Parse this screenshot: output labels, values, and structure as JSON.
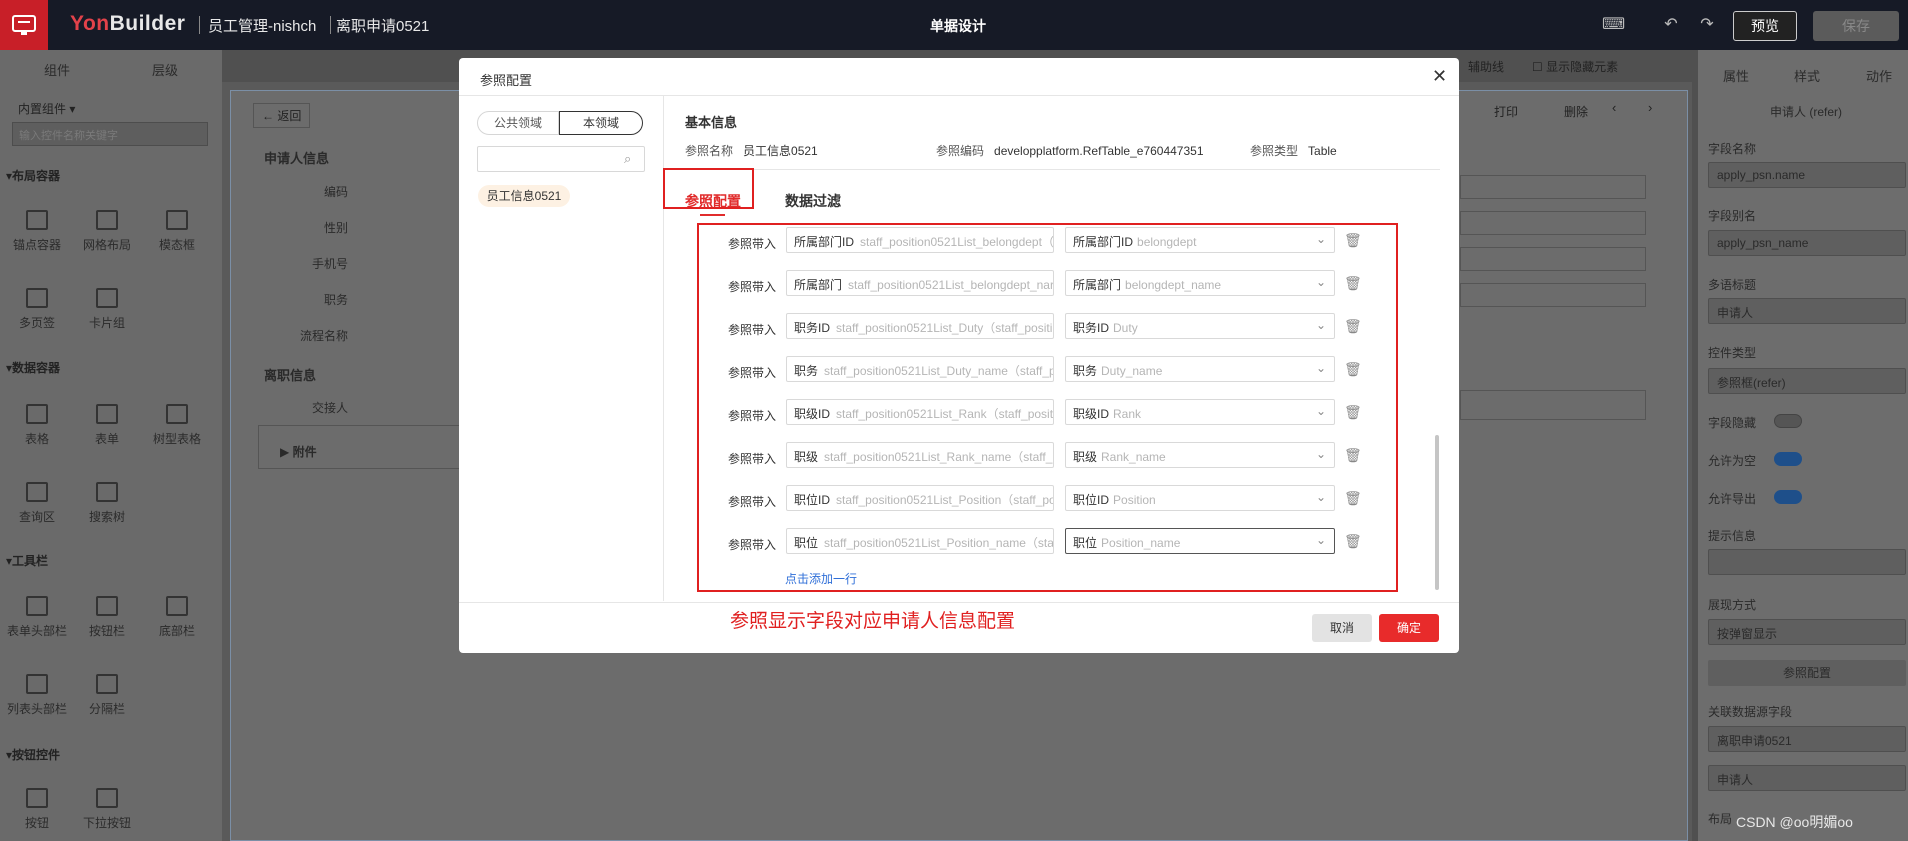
{
  "topbar": {
    "brand_prefix": "Yon",
    "brand_suffix": "Builder",
    "app_name": "员工管理-nishch",
    "page_name": "离职申请0521",
    "center_title": "单据设计",
    "preview_label": "预览",
    "save_label": "保存"
  },
  "left_panel": {
    "tabs": [
      "组件",
      "层级"
    ],
    "dropdown": "内置组件",
    "search_placeholder": "输入控件名称关键字",
    "sections": [
      {
        "title": "布局容器",
        "items": [
          "锚点容器",
          "网格布局",
          "模态框",
          "多页签",
          "卡片组"
        ]
      },
      {
        "title": "数据容器",
        "items": [
          "表格",
          "表单",
          "树型表格",
          "查询区",
          "搜索树"
        ]
      },
      {
        "title": "工具栏",
        "items": [
          "表单头部栏",
          "按钮栏",
          "底部栏",
          "列表头部栏",
          "分隔栏"
        ]
      },
      {
        "title": "按钮控件",
        "items": [
          "按钮",
          "下拉按钮"
        ]
      }
    ]
  },
  "form": {
    "back_label": "返回",
    "print_label": "打印",
    "delete_label": "删除",
    "toolbar_extra": [
      "辅助线",
      "显示隐藏元素"
    ],
    "group1": "申请人信息",
    "fields1": [
      "编码",
      "性别",
      "手机号",
      "职务",
      "流程名称"
    ],
    "group2": "离职信息",
    "fields2": [
      "交接人"
    ],
    "attachment": "附件"
  },
  "right_panel": {
    "tabs": [
      "属性",
      "样式",
      "动作"
    ],
    "subtitle": "申请人 (refer)",
    "items": [
      {
        "label": "字段名称",
        "value": "apply_psn.name"
      },
      {
        "label": "字段别名",
        "value": "apply_psn_name"
      },
      {
        "label": "多语标题",
        "value": "申请人"
      },
      {
        "label": "控件类型",
        "value": "参照框(refer)"
      }
    ],
    "field_hidden": "字段隐藏",
    "allow_empty": "允许为空",
    "allow_export": "允许导出",
    "hint_label": "提示信息",
    "display_label": "展现方式",
    "display_value": "按弹窗显示",
    "ref_config_button": "参照配置",
    "related_label": "关联数据源字段",
    "related_value": "离职申请0521",
    "related_value2": "申请人",
    "layout_label": "布局"
  },
  "modal": {
    "title": "参照配置",
    "tab_public": "公共领域",
    "tab_domain": "本领域",
    "tree_item": "员工信息0521",
    "basic_info_title": "基本信息",
    "ref_name_label": "参照名称",
    "ref_name_value": "员工信息0521",
    "ref_code_label": "参照编码",
    "ref_code_value": "developplatform.RefTable_e760447351",
    "ref_type_label": "参照类型",
    "ref_type_value": "Table",
    "tab_config": "参照配置",
    "tab_filter": "数据过滤",
    "rows": [
      {
        "label": "参照带入",
        "src": "所属部门ID",
        "src_ph": "staff_position0521List_belongdept（",
        "dst": "所属部门ID",
        "dst_ph": "belongdept"
      },
      {
        "label": "参照带入",
        "src": "所属部门",
        "src_ph": "staff_position0521List_belongdept_nar",
        "dst": "所属部门",
        "dst_ph": "belongdept_name"
      },
      {
        "label": "参照带入",
        "src": "职务ID",
        "src_ph": "staff_position0521List_Duty（staff_positi",
        "dst": "职务ID",
        "dst_ph": "Duty"
      },
      {
        "label": "参照带入",
        "src": "职务",
        "src_ph": "staff_position0521List_Duty_name（staff_p",
        "dst": "职务",
        "dst_ph": "Duty_name"
      },
      {
        "label": "参照带入",
        "src": "职级ID",
        "src_ph": "staff_position0521List_Rank（staff_positi",
        "dst": "职级ID",
        "dst_ph": "Rank"
      },
      {
        "label": "参照带入",
        "src": "职级",
        "src_ph": "staff_position0521List_Rank_name（staff_p",
        "dst": "职级",
        "dst_ph": "Rank_name"
      },
      {
        "label": "参照带入",
        "src": "职位ID",
        "src_ph": "staff_position0521List_Position（staff_po",
        "dst": "职位ID",
        "dst_ph": "Position"
      },
      {
        "label": "参照带入",
        "src": "职位",
        "src_ph": "staff_position0521List_Position_name（stal",
        "dst": "职位",
        "dst_ph": "Position_name"
      }
    ],
    "add_row": "点击添加一行",
    "annotation": "参照显示字段对应申请人信息配置",
    "cancel": "取消",
    "ok": "确定"
  },
  "watermark": "CSDN @oo明媚oo"
}
